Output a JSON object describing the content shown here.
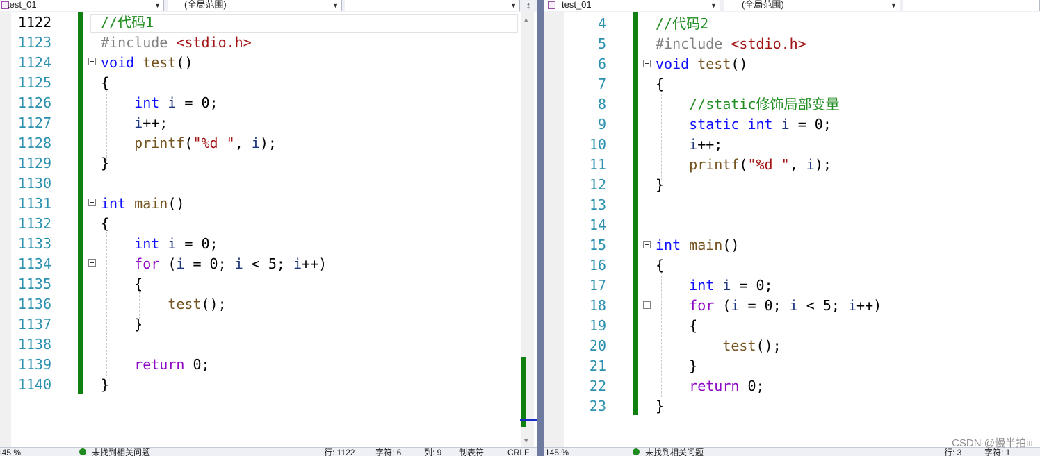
{
  "left": {
    "file_dropdown": "test_01",
    "scope_dropdown": "(全局范围)",
    "member_dropdown": "",
    "split_button": "↕",
    "zoom": "145 %",
    "status": "未找到相关问题",
    "row": "行: 1122",
    "char": "字符: 6",
    "col": "列: 9",
    "tabs": "制表符",
    "eol": "CRLF",
    "lines": [
      {
        "n": "1122",
        "t": [
          [
            "cm",
            "//代码1"
          ]
        ]
      },
      {
        "n": "1123",
        "t": [
          [
            "pp",
            "#include "
          ],
          [
            "st",
            "<stdio.h>"
          ]
        ]
      },
      {
        "n": "1124",
        "t": [
          [
            "kw",
            "void"
          ],
          [
            "pl",
            " "
          ],
          [
            "fn",
            "test"
          ],
          [
            "pl",
            "()"
          ]
        ]
      },
      {
        "n": "1125",
        "t": [
          [
            "pl",
            "{"
          ]
        ]
      },
      {
        "n": "1126",
        "t": [
          [
            "pl",
            "    "
          ],
          [
            "kw",
            "int"
          ],
          [
            "pl",
            " "
          ],
          [
            "var",
            "i"
          ],
          [
            "pl",
            " = 0;"
          ]
        ]
      },
      {
        "n": "1127",
        "t": [
          [
            "pl",
            "    "
          ],
          [
            "var",
            "i"
          ],
          [
            "pl",
            "++;"
          ]
        ]
      },
      {
        "n": "1128",
        "t": [
          [
            "pl",
            "    "
          ],
          [
            "fn",
            "printf"
          ],
          [
            "pl",
            "("
          ],
          [
            "st",
            "\"%d \""
          ],
          [
            "pl",
            ", "
          ],
          [
            "var",
            "i"
          ],
          [
            "pl",
            ");"
          ]
        ]
      },
      {
        "n": "1129",
        "t": [
          [
            "pl",
            "}"
          ]
        ]
      },
      {
        "n": "1130",
        "t": []
      },
      {
        "n": "1131",
        "t": [
          [
            "kw",
            "int"
          ],
          [
            "pl",
            " "
          ],
          [
            "fn",
            "main"
          ],
          [
            "pl",
            "()"
          ]
        ]
      },
      {
        "n": "1132",
        "t": [
          [
            "pl",
            "{"
          ]
        ]
      },
      {
        "n": "1133",
        "t": [
          [
            "pl",
            "    "
          ],
          [
            "kw",
            "int"
          ],
          [
            "pl",
            " "
          ],
          [
            "var",
            "i"
          ],
          [
            "pl",
            " = 0;"
          ]
        ]
      },
      {
        "n": "1134",
        "t": [
          [
            "pl",
            "    "
          ],
          [
            "ctl",
            "for"
          ],
          [
            "pl",
            " ("
          ],
          [
            "var",
            "i"
          ],
          [
            "pl",
            " = 0; "
          ],
          [
            "var",
            "i"
          ],
          [
            "pl",
            " < 5; "
          ],
          [
            "var",
            "i"
          ],
          [
            "pl",
            "++)"
          ]
        ]
      },
      {
        "n": "1135",
        "t": [
          [
            "pl",
            "    {"
          ]
        ]
      },
      {
        "n": "1136",
        "t": [
          [
            "pl",
            "        "
          ],
          [
            "fn",
            "test"
          ],
          [
            "pl",
            "();"
          ]
        ]
      },
      {
        "n": "1137",
        "t": [
          [
            "pl",
            "    }"
          ]
        ]
      },
      {
        "n": "1138",
        "t": []
      },
      {
        "n": "1139",
        "t": [
          [
            "pl",
            "    "
          ],
          [
            "ctl",
            "return"
          ],
          [
            "pl",
            " 0;"
          ]
        ]
      },
      {
        "n": "1140",
        "t": [
          [
            "pl",
            "}"
          ]
        ]
      }
    ]
  },
  "right": {
    "file_dropdown": "test_01",
    "scope_dropdown": "(全局范围)",
    "member_dropdown": "",
    "zoom": "145 %",
    "status": "未找到相关问题",
    "row": "行: 3",
    "char": "字符: 1",
    "lines": [
      {
        "n": "4",
        "t": [
          [
            "cm",
            "//代码2"
          ]
        ]
      },
      {
        "n": "5",
        "t": [
          [
            "pp",
            "#include "
          ],
          [
            "st",
            "<stdio.h>"
          ]
        ]
      },
      {
        "n": "6",
        "t": [
          [
            "kw",
            "void"
          ],
          [
            "pl",
            " "
          ],
          [
            "fn",
            "test"
          ],
          [
            "pl",
            "()"
          ]
        ]
      },
      {
        "n": "7",
        "t": [
          [
            "pl",
            "{"
          ]
        ]
      },
      {
        "n": "8",
        "t": [
          [
            "pl",
            "    "
          ],
          [
            "cm",
            "//static修饰局部变量"
          ]
        ]
      },
      {
        "n": "9",
        "t": [
          [
            "pl",
            "    "
          ],
          [
            "kw",
            "static"
          ],
          [
            "pl",
            " "
          ],
          [
            "kw",
            "int"
          ],
          [
            "pl",
            " "
          ],
          [
            "var",
            "i"
          ],
          [
            "pl",
            " = 0;"
          ]
        ]
      },
      {
        "n": "10",
        "t": [
          [
            "pl",
            "    "
          ],
          [
            "var",
            "i"
          ],
          [
            "pl",
            "++;"
          ]
        ]
      },
      {
        "n": "11",
        "t": [
          [
            "pl",
            "    "
          ],
          [
            "fn",
            "printf"
          ],
          [
            "pl",
            "("
          ],
          [
            "st",
            "\"%d \""
          ],
          [
            "pl",
            ", "
          ],
          [
            "var",
            "i"
          ],
          [
            "pl",
            ");"
          ]
        ]
      },
      {
        "n": "12",
        "t": [
          [
            "pl",
            "}"
          ]
        ]
      },
      {
        "n": "13",
        "t": []
      },
      {
        "n": "14",
        "t": []
      },
      {
        "n": "15",
        "t": [
          [
            "kw",
            "int"
          ],
          [
            "pl",
            " "
          ],
          [
            "fn",
            "main"
          ],
          [
            "pl",
            "()"
          ]
        ]
      },
      {
        "n": "16",
        "t": [
          [
            "pl",
            "{"
          ]
        ]
      },
      {
        "n": "17",
        "t": [
          [
            "pl",
            "    "
          ],
          [
            "kw",
            "int"
          ],
          [
            "pl",
            " "
          ],
          [
            "var",
            "i"
          ],
          [
            "pl",
            " = 0;"
          ]
        ]
      },
      {
        "n": "18",
        "t": [
          [
            "pl",
            "    "
          ],
          [
            "ctl",
            "for"
          ],
          [
            "pl",
            " ("
          ],
          [
            "var",
            "i"
          ],
          [
            "pl",
            " = 0; "
          ],
          [
            "var",
            "i"
          ],
          [
            "pl",
            " < 5; "
          ],
          [
            "var",
            "i"
          ],
          [
            "pl",
            "++)"
          ]
        ]
      },
      {
        "n": "19",
        "t": [
          [
            "pl",
            "    {"
          ]
        ]
      },
      {
        "n": "20",
        "t": [
          [
            "pl",
            "        "
          ],
          [
            "fn",
            "test"
          ],
          [
            "pl",
            "();"
          ]
        ]
      },
      {
        "n": "21",
        "t": [
          [
            "pl",
            "    }"
          ]
        ]
      },
      {
        "n": "22",
        "t": [
          [
            "pl",
            "    "
          ],
          [
            "ctl",
            "return"
          ],
          [
            "pl",
            " 0;"
          ]
        ]
      },
      {
        "n": "23",
        "t": [
          [
            "pl",
            "}"
          ]
        ]
      }
    ]
  },
  "watermark": "CSDN @慢半拍iii",
  "colors": {
    "modified_bar": "#108010",
    "line_number": "#2b91af",
    "keyword": "#1010ff",
    "control": "#8f08c4",
    "comment": "#1e8c1e",
    "string": "#a31515"
  }
}
